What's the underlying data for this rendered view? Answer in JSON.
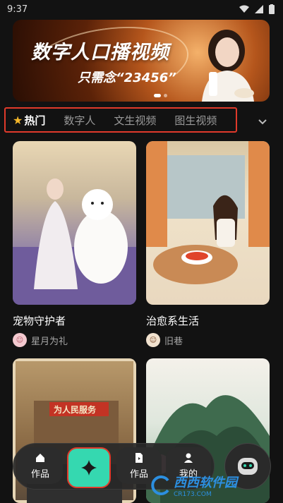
{
  "status": {
    "time": "9:37"
  },
  "banner": {
    "title": "数字人口播视频",
    "subtitle": "只需念“23456”"
  },
  "tabs": [
    {
      "label": "热门",
      "active": true,
      "icon": "star-icon"
    },
    {
      "label": "数字人",
      "active": false
    },
    {
      "label": "文生视频",
      "active": false
    },
    {
      "label": "图生视频",
      "active": false
    }
  ],
  "cards": [
    {
      "caption": "宠物守护者",
      "author": "星月为礼"
    },
    {
      "caption": "治愈系生活",
      "author": "旧巷"
    },
    {
      "sign": "为人民服务"
    },
    {}
  ],
  "nav": {
    "works_left": "作品",
    "works_right": "作品",
    "mine": "我的"
  },
  "watermark": {
    "title": "西西软件园",
    "url": "CR173.COM"
  },
  "colors": {
    "accent": "#35d8b0",
    "highlight": "#e03a2b",
    "star": "#f5b72a"
  }
}
